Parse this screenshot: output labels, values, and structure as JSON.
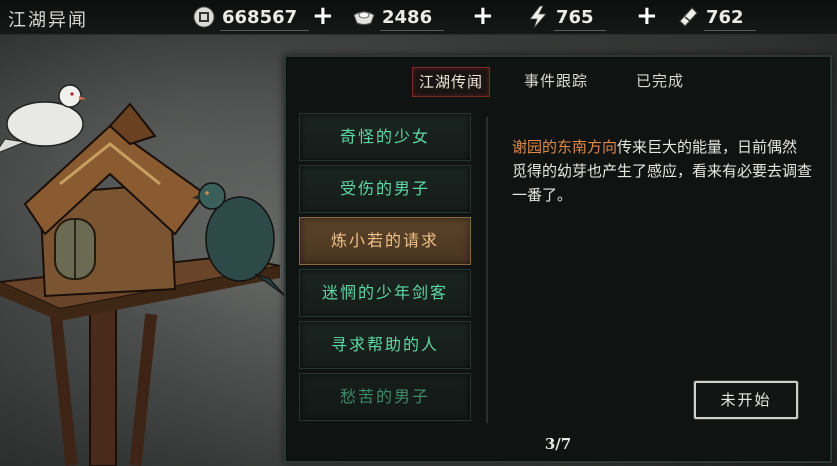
{
  "header": {
    "title": "江湖异闻"
  },
  "resources": [
    {
      "icon": "coin-icon",
      "value": "668567"
    },
    {
      "icon": "silver-ingot-icon",
      "value": "2486"
    },
    {
      "icon": "lightning-icon",
      "value": "765"
    },
    {
      "icon": "ticket-icon",
      "value": "762"
    }
  ],
  "plus_label": "+",
  "tabs": [
    {
      "label": "江湖传闻",
      "active": true
    },
    {
      "label": "事件跟踪",
      "active": false
    },
    {
      "label": "已完成",
      "active": false
    }
  ],
  "quests": [
    {
      "label": "奇怪的少女"
    },
    {
      "label": "受伤的男子"
    },
    {
      "label": "炼小若的请求",
      "selected": true
    },
    {
      "label": "迷惘的少年剑客"
    },
    {
      "label": "寻求帮助的人"
    },
    {
      "label": "愁苦的男子"
    }
  ],
  "description": {
    "highlight": "谢园的东南方向",
    "text": "传来巨大的能量，日前偶然觅得的幼芽也产生了感应，看来有必要去调查一番了。"
  },
  "status_button": "未开始",
  "pager": "3/7",
  "colors": {
    "quest_text": "#5fd8a4",
    "selected_bg": "#5a4428",
    "highlight_text": "#e08a4a",
    "active_tab_border": "#7a2a22"
  }
}
